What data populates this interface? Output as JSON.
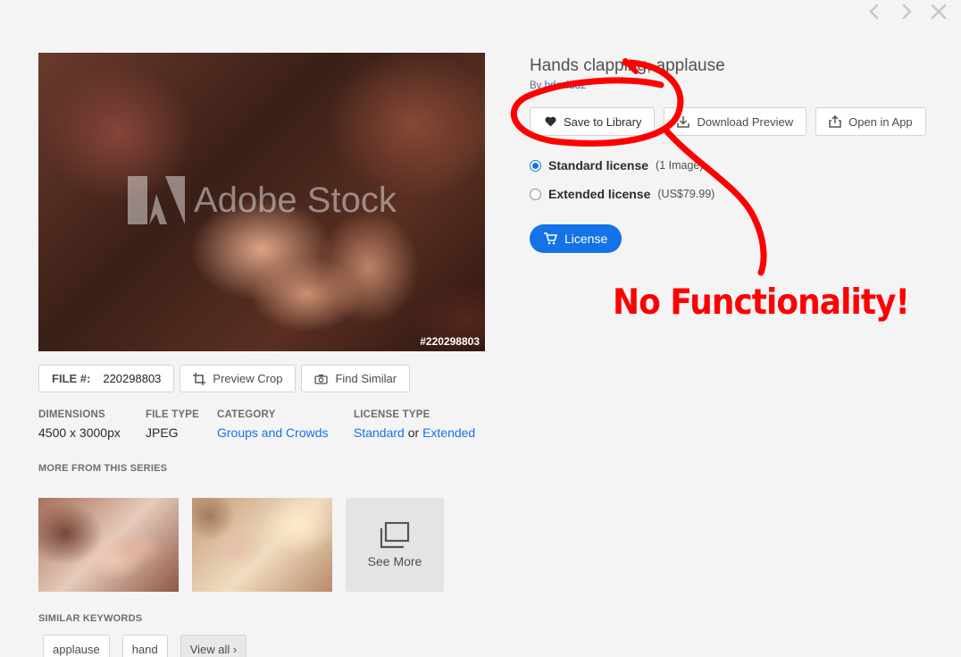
{
  "asset": {
    "title": "Hands clapping, applause",
    "by_prefix": "By",
    "author": "bdavid32",
    "stock_id_overlay": "#220298803",
    "watermark": "Adobe Stock"
  },
  "actions": {
    "save_label": "Save to Library",
    "download_label": "Download Preview",
    "open_label": "Open in App"
  },
  "licenses": [
    {
      "name": "Standard license",
      "detail": "(1 Image)",
      "selected": true
    },
    {
      "name": "Extended license",
      "detail": "(US$79.99)",
      "selected": false
    }
  ],
  "license_button": "License",
  "imgbar": {
    "file_label": "FILE #:",
    "file_value": "220298803",
    "preview_crop": "Preview Crop",
    "find_similar": "Find Similar"
  },
  "meta": {
    "dimensions_label": "DIMENSIONS",
    "dimensions_value": "4500 x 3000px",
    "filetype_label": "FILE TYPE",
    "filetype_value": "JPEG",
    "category_label": "CATEGORY",
    "category_value": "Groups and Crowds",
    "license_type_label": "LICENSE TYPE",
    "license_standard": "Standard",
    "license_or": "or",
    "license_extended": "Extended"
  },
  "series": {
    "title": "MORE FROM THIS SERIES",
    "see_more": "See More"
  },
  "keywords": {
    "title": "SIMILAR KEYWORDS",
    "items": [
      "applause",
      "hand"
    ],
    "view_all": "View all ›"
  },
  "annotation": {
    "text": "No Functionality!",
    "color": "#ff0000"
  },
  "colors": {
    "accent": "#1473e6"
  }
}
